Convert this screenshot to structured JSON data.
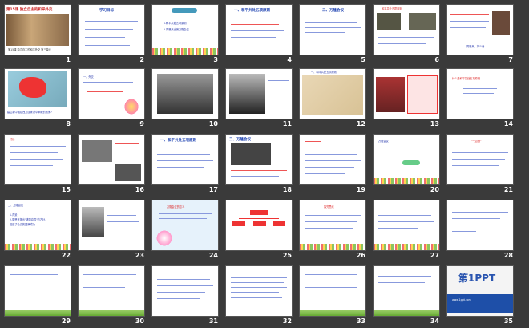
{
  "slides": [
    {
      "n": "1",
      "title": "第15课 独立自主的和平外交",
      "caption": "第15课 独立自主的和平外交 第三单元"
    },
    {
      "n": "2",
      "title": "学习目标"
    },
    {
      "n": "3",
      "items": [
        "1.和平共处五项原则",
        "2.周恩来出席万隆会议"
      ]
    },
    {
      "n": "4",
      "title": "一、和平共处五项原则"
    },
    {
      "n": "5",
      "title": "二、万隆会议"
    },
    {
      "n": "6",
      "title": "和平共处五项原则"
    },
    {
      "n": "7",
      "caption": "周恩来、刘少奇"
    },
    {
      "n": "8",
      "question": "建立新中国后西方国家对华采取的政策?"
    },
    {
      "n": "9",
      "text": "一、外交"
    },
    {
      "n": "10",
      "text": ""
    },
    {
      "n": "11",
      "text": ""
    },
    {
      "n": "12",
      "text": "一、和平共处五项原则"
    },
    {
      "n": "13",
      "text": ""
    },
    {
      "n": "14",
      "text": "什么是和平共处五项原则"
    },
    {
      "n": "15",
      "text": "讨论"
    },
    {
      "n": "16",
      "text": ""
    },
    {
      "n": "17",
      "title": "一、和平共处五项原则"
    },
    {
      "n": "18",
      "title": "二、万隆会议"
    },
    {
      "n": "19",
      "text": ""
    },
    {
      "n": "20",
      "title": "万隆会议"
    },
    {
      "n": "21",
      "text": "\"一边倒\""
    },
    {
      "n": "22",
      "title": "二、万隆会议",
      "lines": [
        "1.背景",
        "2.周恩来提出\"求同存异\"的方针,",
        "促进了会议的圆满成功"
      ]
    },
    {
      "n": "23",
      "text": ""
    },
    {
      "n": "24",
      "title": "万隆会议的意义"
    },
    {
      "n": "25",
      "text": ""
    },
    {
      "n": "26",
      "title": "探究思维"
    },
    {
      "n": "27",
      "text": ""
    },
    {
      "n": "28",
      "text": ""
    },
    {
      "n": "29",
      "text": ""
    },
    {
      "n": "30",
      "text": ""
    },
    {
      "n": "31",
      "text": ""
    },
    {
      "n": "32",
      "text": ""
    },
    {
      "n": "33",
      "text": ""
    },
    {
      "n": "34",
      "text": ""
    },
    {
      "n": "35",
      "logo": "第1PPT",
      "footer": "www.1ppt.com"
    }
  ]
}
